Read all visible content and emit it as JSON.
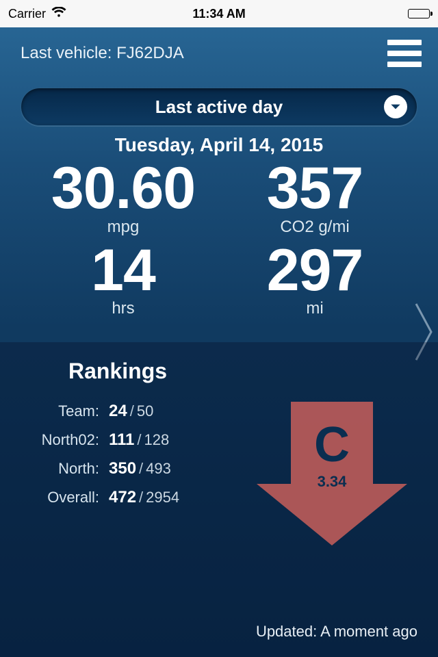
{
  "status": {
    "carrier": "Carrier",
    "time": "11:34 AM"
  },
  "header": {
    "last_vehicle_label": "Last vehicle: FJ62DJA"
  },
  "dropdown": {
    "label": "Last active day"
  },
  "date": "Tuesday, April 14, 2015",
  "stats": {
    "mpg": {
      "value": "30.60",
      "unit": "mpg"
    },
    "co2": {
      "value": "357",
      "unit": "CO2 g/mi"
    },
    "hrs": {
      "value": "14",
      "unit": "hrs"
    },
    "mi": {
      "value": "297",
      "unit": "mi"
    }
  },
  "rankings": {
    "title": "Rankings",
    "rows": [
      {
        "label": "Team:",
        "pos": "24",
        "total": "50"
      },
      {
        "label": "North02:",
        "pos": "111",
        "total": "128"
      },
      {
        "label": "North:",
        "pos": "350",
        "total": "493"
      },
      {
        "label": "Overall:",
        "pos": "472",
        "total": "2954"
      }
    ]
  },
  "grade": {
    "letter": "C",
    "score": "3.34"
  },
  "updated": "Updated: A moment ago"
}
